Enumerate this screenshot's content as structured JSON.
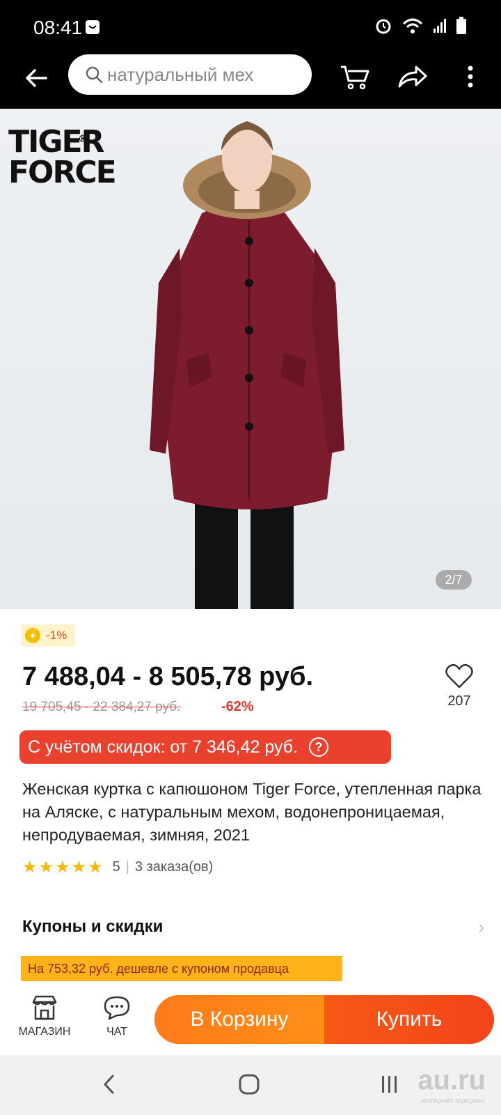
{
  "status_bar": {
    "time": "08:41"
  },
  "search": {
    "placeholder": "натуральный мех"
  },
  "image": {
    "counter": "2/7",
    "brand_line1": "TIGER",
    "brand_line2": "FORCE"
  },
  "promo": {
    "badge": "-1%"
  },
  "price": {
    "range": "7 488,04 - 8 505,78 руб.",
    "old_range": "19 705,45 - 22 384,27 руб.",
    "discount": "-62%",
    "with_discounts": "С учётом скидок: от 7 346,42 руб."
  },
  "favorites": {
    "count": "207"
  },
  "product": {
    "title": "Женская куртка с капюшоном Tiger Force, утепленная парка на Аляске, с натуральным мехом, водонепроницаемая, непродуваемая, зимняя, 2021",
    "rating": "5",
    "orders": "3 заказа(ов)"
  },
  "coupons": {
    "title": "Купоны и скидки",
    "banner": "На 753,32 руб. дешевле с купоном продавца"
  },
  "actions": {
    "store_label": "МАГАЗИН",
    "chat_label": "ЧАТ",
    "cart_label": "В Корзину",
    "buy_label": "Купить"
  },
  "watermark": {
    "main": "au.ru",
    "sub": "интернет-аукцион"
  },
  "colors": {
    "accent_orange": "#ff7a1a",
    "accent_red": "#e9412e",
    "jacket": "#7d1c2c"
  }
}
